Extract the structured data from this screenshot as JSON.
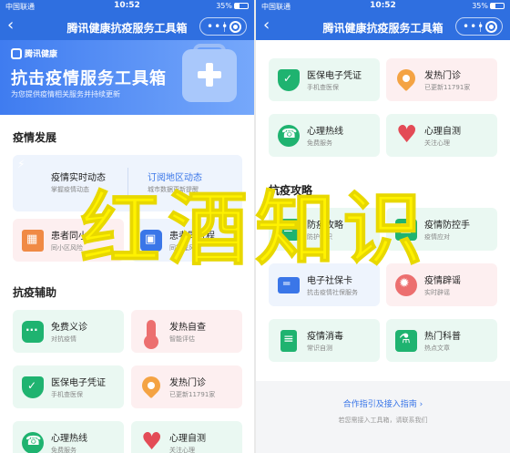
{
  "status": {
    "carrier": "中国联通",
    "time": "10:52",
    "battery": "35%"
  },
  "navbar": {
    "title": "腾讯健康抗疫服务工具箱",
    "back_icon": "chevron-left-icon",
    "more_icon": "more-dots-icon",
    "close_icon": "target-icon"
  },
  "banner": {
    "brand": "腾讯健康",
    "headline": "抗击疫情服务工具箱",
    "subtitle": "为您提供疫情相关服务并持续更新"
  },
  "left": {
    "section1": "疫情发展",
    "realtime": {
      "title": "疫情实时动态",
      "sub": "掌握疫情动态"
    },
    "subscribe": {
      "title": "订阅地区动态",
      "sub": "城市数据更新提醒"
    },
    "community": {
      "title": "患者同小区",
      "sub": "同小区风险"
    },
    "travel": {
      "title": "患者同行程",
      "sub": "同行程风险"
    },
    "section2": "抗疫辅助",
    "cards": [
      {
        "title": "免费义诊",
        "sub": "对抗疫情"
      },
      {
        "title": "发热自查",
        "sub": "智能评估"
      },
      {
        "title": "医保电子凭证",
        "sub": "手机查医保"
      },
      {
        "title": "发热门诊",
        "sub": "已更新11791家"
      },
      {
        "title": "心理热线",
        "sub": "免费服务"
      },
      {
        "title": "心理自测",
        "sub": "关注心理"
      }
    ]
  },
  "right": {
    "top_cards": [
      {
        "title": "医保电子凭证",
        "sub": "手机查医保"
      },
      {
        "title": "发热门诊",
        "sub": "已更新11791家"
      },
      {
        "title": "心理热线",
        "sub": "免费服务"
      },
      {
        "title": "心理自测",
        "sub": "关注心理"
      }
    ],
    "section": "抗疫攻略",
    "guide_cards": [
      {
        "title": "防疫攻略",
        "sub": "防护常识"
      },
      {
        "title": "疫情防控手",
        "sub": "疫情应对"
      },
      {
        "title": "电子社保卡",
        "sub": "抗击疫情社保服务"
      },
      {
        "title": "疫情辟谣",
        "sub": "实时辟谣"
      },
      {
        "title": "疫情消毒",
        "sub": "常识自测"
      },
      {
        "title": "热门科普",
        "sub": "热点文章"
      }
    ],
    "footer_link": "合作指引及接入指南",
    "footer_sub": "若您需接入工具箱，请联系我们"
  },
  "watermark": "红酒知识",
  "colors": {
    "accent": "#2f6fe0",
    "green": "#1fb370",
    "red": "#e34b56",
    "orange": "#f4a343",
    "watermark": "#fff200"
  }
}
